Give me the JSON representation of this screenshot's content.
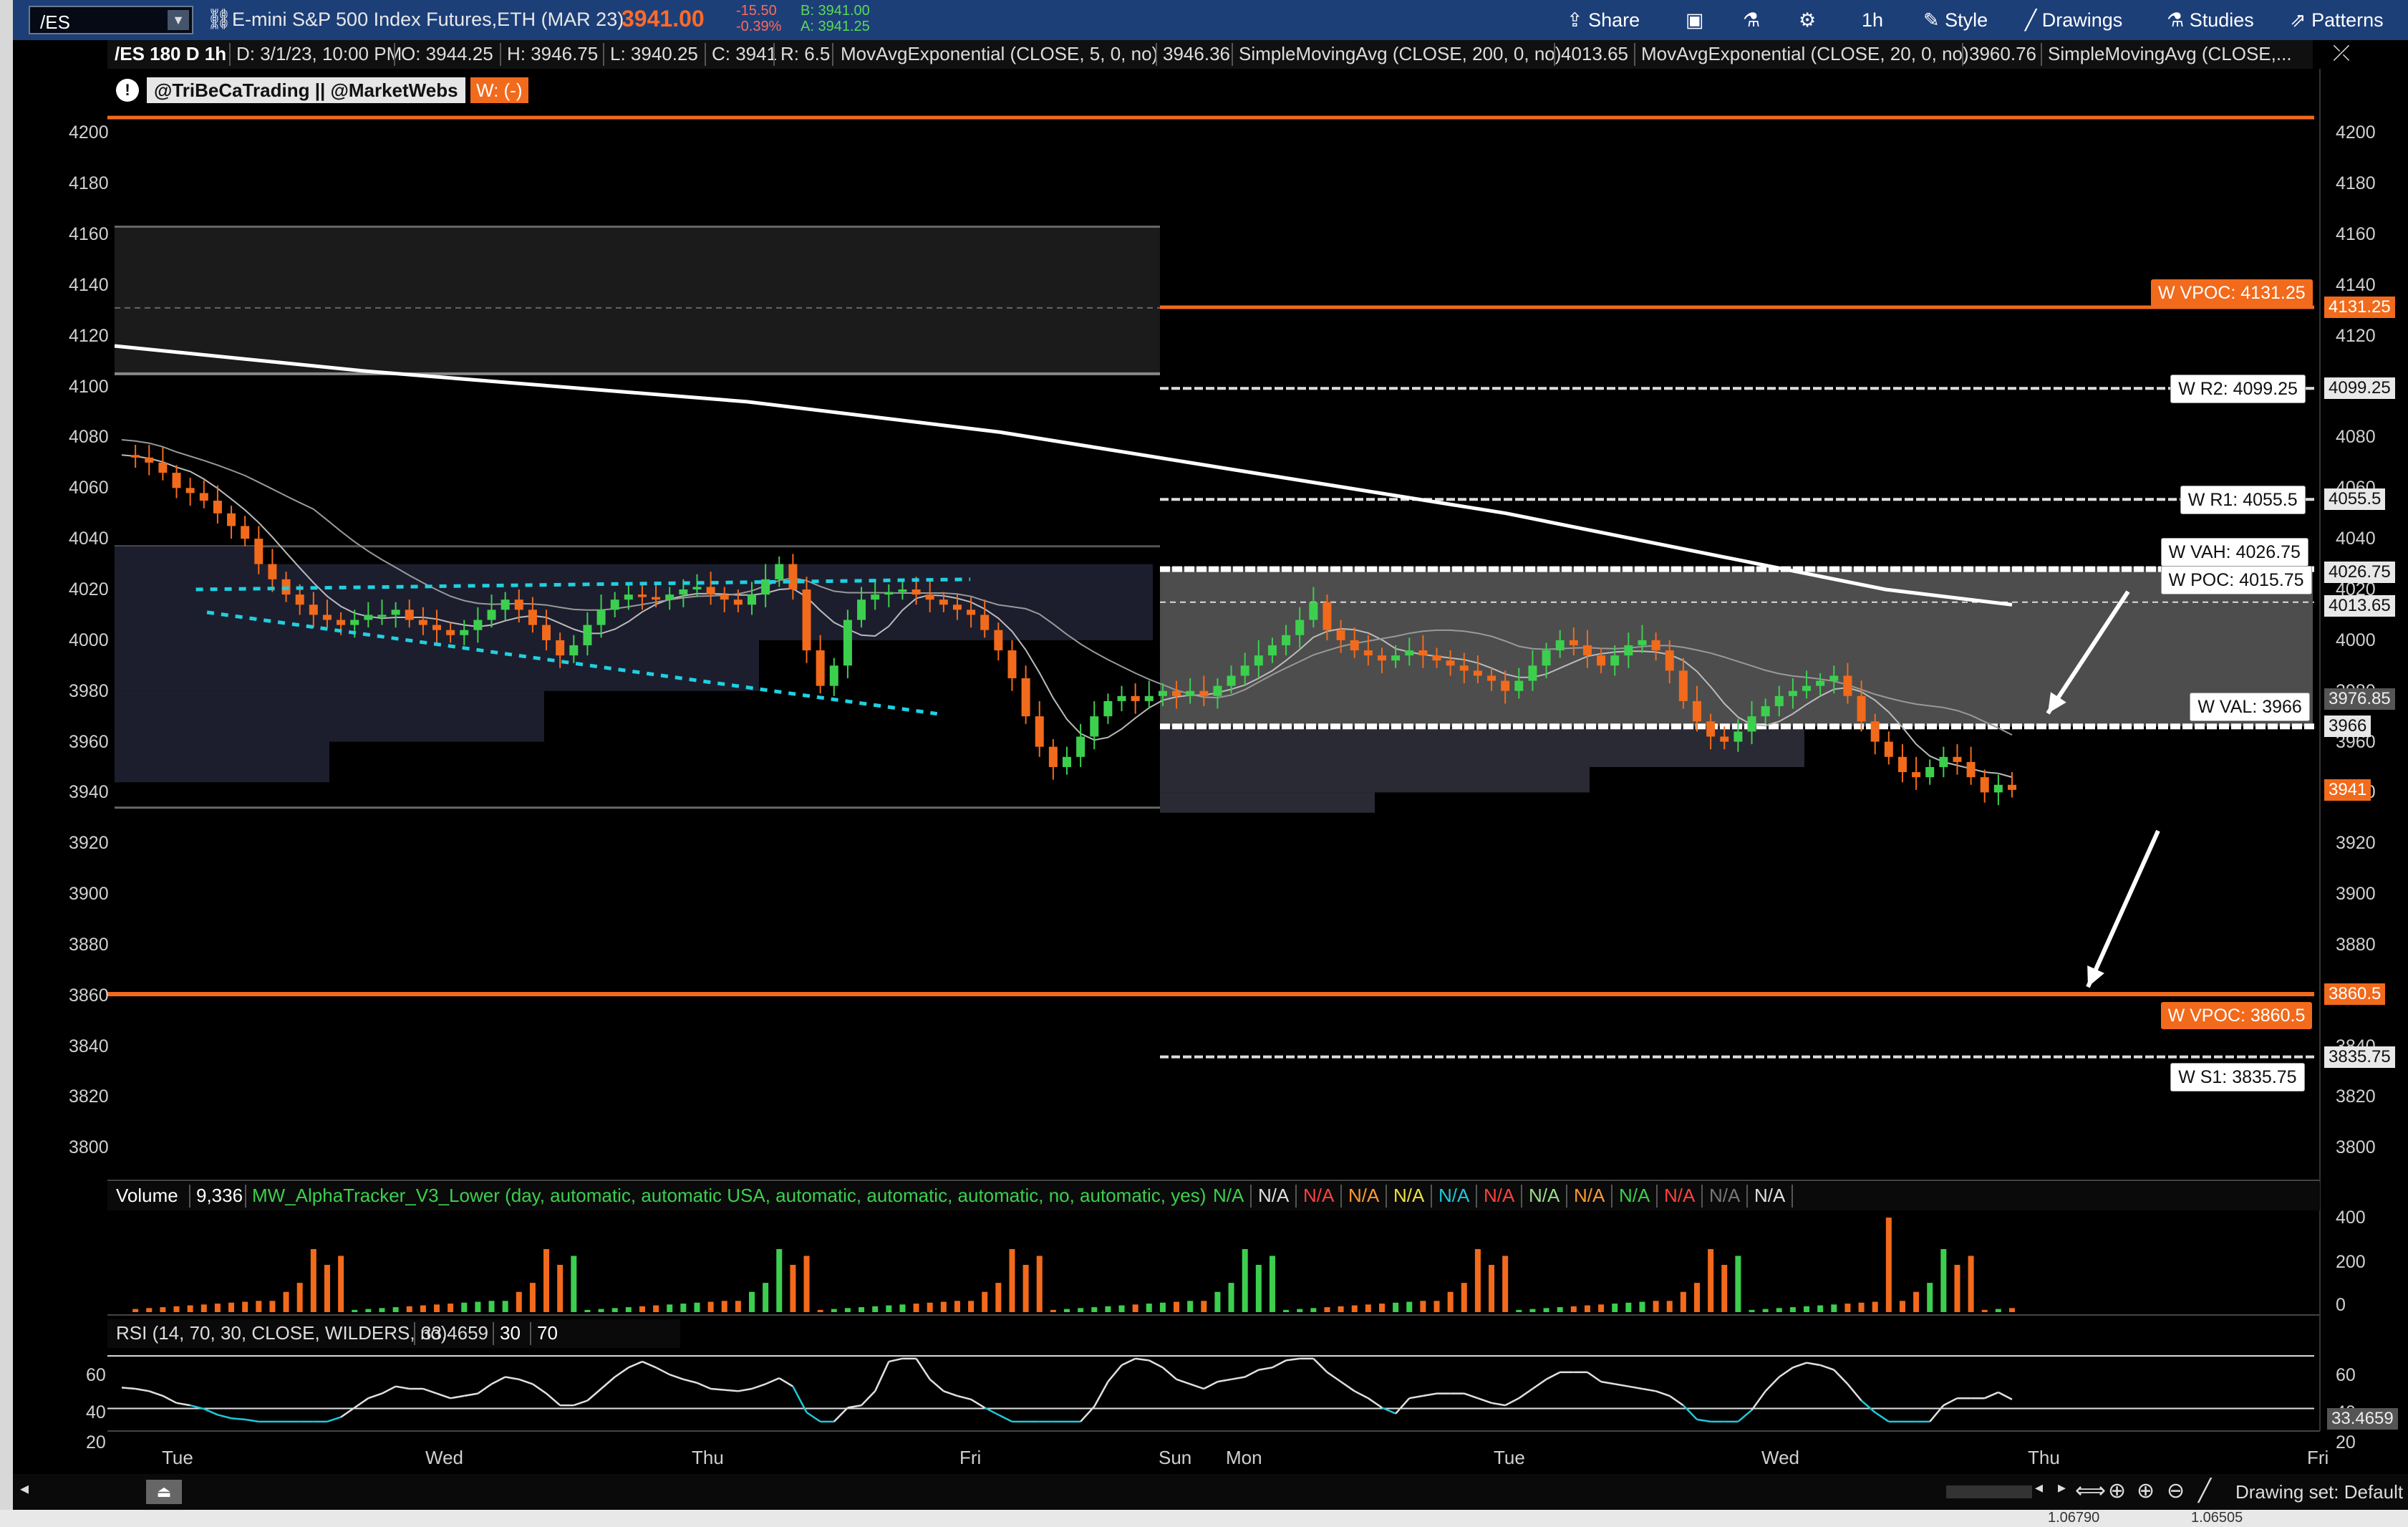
{
  "toolbar": {
    "symbol": "/ES",
    "instrument": "E-mini S&P 500 Index Futures,ETH (MAR 23)",
    "last_price": "3941.00",
    "change": "-15.50",
    "change_pct": "-0.39%",
    "bid": "B: 3941.00",
    "ask": "A: 3941.25",
    "share_label": "Share",
    "timeframe_label": "1h",
    "style_label": "Style",
    "drawings_label": "Drawings",
    "studies_label": "Studies",
    "patterns_label": "Patterns"
  },
  "subheader": {
    "series": "/ES 180 D 1h",
    "date": "D: 3/1/23, 10:00 PM",
    "open": "O: 3944.25",
    "high": "H: 3946.75",
    "low": "L: 3940.25",
    "close": "C: 3941",
    "range": "R: 6.5",
    "ema5_label": "MovAvgExponential (CLOSE, 5, 0, no)",
    "ema5_value": "3946.36",
    "sma200_label": "SimpleMovingAvg (CLOSE, 200, 0, no)",
    "sma200_value": "4013.65",
    "ema20_label": "MovAvgExponential (CLOSE, 20, 0, no)",
    "ema20_value": "3960.76",
    "sma_extra_label": "SimpleMovingAvg (CLOSE,..."
  },
  "watermark": {
    "text": "@TriBeCaTrading || @MarketWebs",
    "w_label": "W: (-)"
  },
  "price_axis": {
    "ticks": [
      "4200",
      "4180",
      "4160",
      "4140",
      "4120",
      "4100",
      "4080",
      "4060",
      "4040",
      "4020",
      "4000",
      "3980",
      "3960",
      "3940",
      "3920",
      "3900",
      "3880",
      "3860",
      "3840",
      "3820",
      "3800"
    ]
  },
  "levels": [
    {
      "label": "W VPOC: 4131.25",
      "price_tag": "4131.25",
      "style": "orange"
    },
    {
      "label": "W R2: 4099.25",
      "price_tag": "4099.25",
      "style": "white"
    },
    {
      "label": "W R1: 4055.5",
      "price_tag": "4055.5",
      "style": "white"
    },
    {
      "label": "W VAH: 4026.75",
      "price_tag": "4026.75",
      "style": "white"
    },
    {
      "label": "W POC: 4015.75",
      "price_tag": "4013.65",
      "style": "white"
    },
    {
      "label": "W VAL: 3966",
      "price_tag": "3976.85",
      "style": "white"
    },
    {
      "label": "",
      "price_tag": "3966",
      "style": "white"
    },
    {
      "label": "",
      "price_tag": "3941",
      "style": "orange"
    },
    {
      "label": "W VPOC: 3860.5",
      "price_tag": "3860.5",
      "style": "orange"
    },
    {
      "label": "W S1: 3835.75",
      "price_tag": "3835.75",
      "style": "white"
    }
  ],
  "volume_panel": {
    "label": "Volume",
    "value": "9,336",
    "study": "MW_AlphaTracker_V3_Lower (day, automatic, automatic USA, automatic, automatic, automatic, no, automatic, yes)",
    "na_flags": [
      {
        "text": "N/A",
        "color": "#3ccf4e"
      },
      {
        "text": "N/A",
        "color": "#e0e0e0"
      },
      {
        "text": "N/A",
        "color": "#ff4040"
      },
      {
        "text": "N/A",
        "color": "#ff9a2e"
      },
      {
        "text": "N/A",
        "color": "#f0e040"
      },
      {
        "text": "N/A",
        "color": "#20c8d8"
      },
      {
        "text": "N/A",
        "color": "#ff4040"
      },
      {
        "text": "N/A",
        "color": "#9adf8a"
      },
      {
        "text": "N/A",
        "color": "#ff9a2e"
      },
      {
        "text": "N/A",
        "color": "#3ccf4e"
      },
      {
        "text": "N/A",
        "color": "#ff4040"
      },
      {
        "text": "N/A",
        "color": "#777777"
      },
      {
        "text": "N/A",
        "color": "#e0e0e0"
      }
    ],
    "axis_ticks": [
      "400",
      "200",
      "0"
    ]
  },
  "rsi_panel": {
    "label": "RSI (14, 70, 30, CLOSE, WILDERS, no)",
    "value": "33.4659",
    "oversold": "30",
    "overbought": "70",
    "axis_ticks": [
      "60",
      "40",
      "20"
    ],
    "value_tag": "33.4659"
  },
  "time_axis": {
    "labels": [
      "Tue",
      "Wed",
      "Thu",
      "Fri",
      "Sun",
      "Mon",
      "Tue",
      "Wed",
      "Thu",
      "Fri"
    ]
  },
  "bottombar": {
    "drawing_set": "Drawing set: Default",
    "footer_left": "1.06790",
    "footer_right": "1.06505"
  },
  "colors": {
    "background": "#000000",
    "bull": "#3ccf4e",
    "bear": "#f26a1b",
    "vpoc": "#f26a1b",
    "level": "#ffffff",
    "trendline": "#20d0e0",
    "toolbar": "#1d3f78"
  },
  "chart_data": {
    "type": "candlestick",
    "timeframe": "1h",
    "ylim": [
      3795,
      4210
    ],
    "candles_close_path": [
      4073,
      4072,
      4070,
      4066,
      4060,
      4058,
      4055,
      4050,
      4045,
      4040,
      4030,
      4024,
      4018,
      4014,
      4010,
      4008,
      4006,
      4008,
      4010,
      4010,
      4012,
      4008,
      4006,
      4004,
      4002,
      4004,
      4008,
      4012,
      4016,
      4012,
      4006,
      4000,
      3994,
      3998,
      4006,
      4012,
      4016,
      4018,
      4017,
      4016,
      4018,
      4020,
      4021,
      4018,
      4016,
      4014,
      4018,
      4024,
      4030,
      4020,
      3996,
      3982,
      3990,
      4008,
      4016,
      4018,
      4019,
      4020,
      4018,
      4016,
      4014,
      4012,
      4010,
      4004,
      3996,
      3985,
      3970,
      3958,
      3950,
      3954,
      3962,
      3970,
      3976,
      3978,
      3976,
      3978,
      3980,
      3978,
      3980,
      3978,
      3982,
      3986,
      3990,
      3994,
      3998,
      4002,
      4008,
      4015,
      4004,
      4000,
      3996,
      3994,
      3992,
      3994,
      3996,
      3994,
      3992,
      3990,
      3988,
      3986,
      3984,
      3980,
      3984,
      3990,
      3996,
      4000,
      3998,
      3994,
      3990,
      3994,
      3998,
      4000,
      3996,
      3988,
      3976,
      3968,
      3962,
      3960,
      3964,
      3970,
      3974,
      3978,
      3980,
      3982,
      3984,
      3986,
      3978,
      3968,
      3960,
      3954,
      3948,
      3946,
      3950,
      3954,
      3952,
      3946,
      3940,
      3943,
      3941
    ],
    "trendlines": [
      {
        "from": [
          0.04,
          4020
        ],
        "to": [
          0.39,
          4024
        ]
      },
      {
        "from": [
          0.045,
          4011
        ],
        "to": [
          0.375,
          3971
        ]
      }
    ],
    "sma200": [
      4116,
      4111,
      4106,
      4102,
      4098,
      4094,
      4088,
      4082,
      4074,
      4066,
      4058,
      4050,
      4040,
      4030,
      4020,
      4014
    ]
  }
}
